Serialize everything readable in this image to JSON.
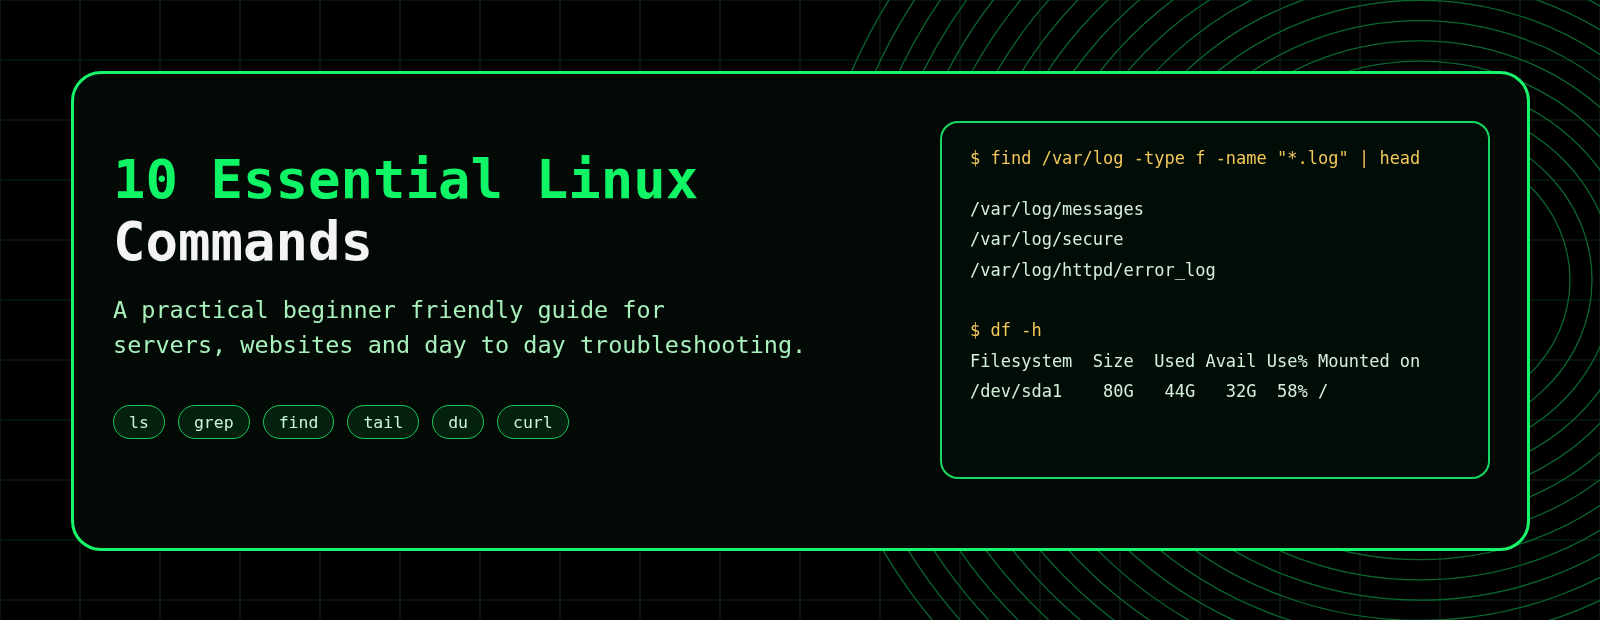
{
  "hero": {
    "title_lines": [
      {
        "text": "10 Essential Linux",
        "color": "#10f566"
      },
      {
        "text": "Commands",
        "color": "#f4f4f4"
      }
    ],
    "subtitle_lines": [
      "A practical beginner friendly guide for",
      "servers, websites and day to day troubleshooting."
    ],
    "tags": [
      "ls",
      "grep",
      "find",
      "tail",
      "du",
      "curl"
    ]
  },
  "terminal": {
    "blocks": [
      {
        "command": "$ find /var/log -type f -name \"*.log\" | head",
        "output": [
          "/var/log/messages",
          "/var/log/secure",
          "/var/log/httpd/error_log"
        ]
      },
      {
        "command": "$ df -h",
        "output": [
          "Filesystem  Size  Used Avail Use% Mounted on",
          "/dev/sda1    80G   44G   32G  58% /"
        ]
      }
    ]
  }
}
